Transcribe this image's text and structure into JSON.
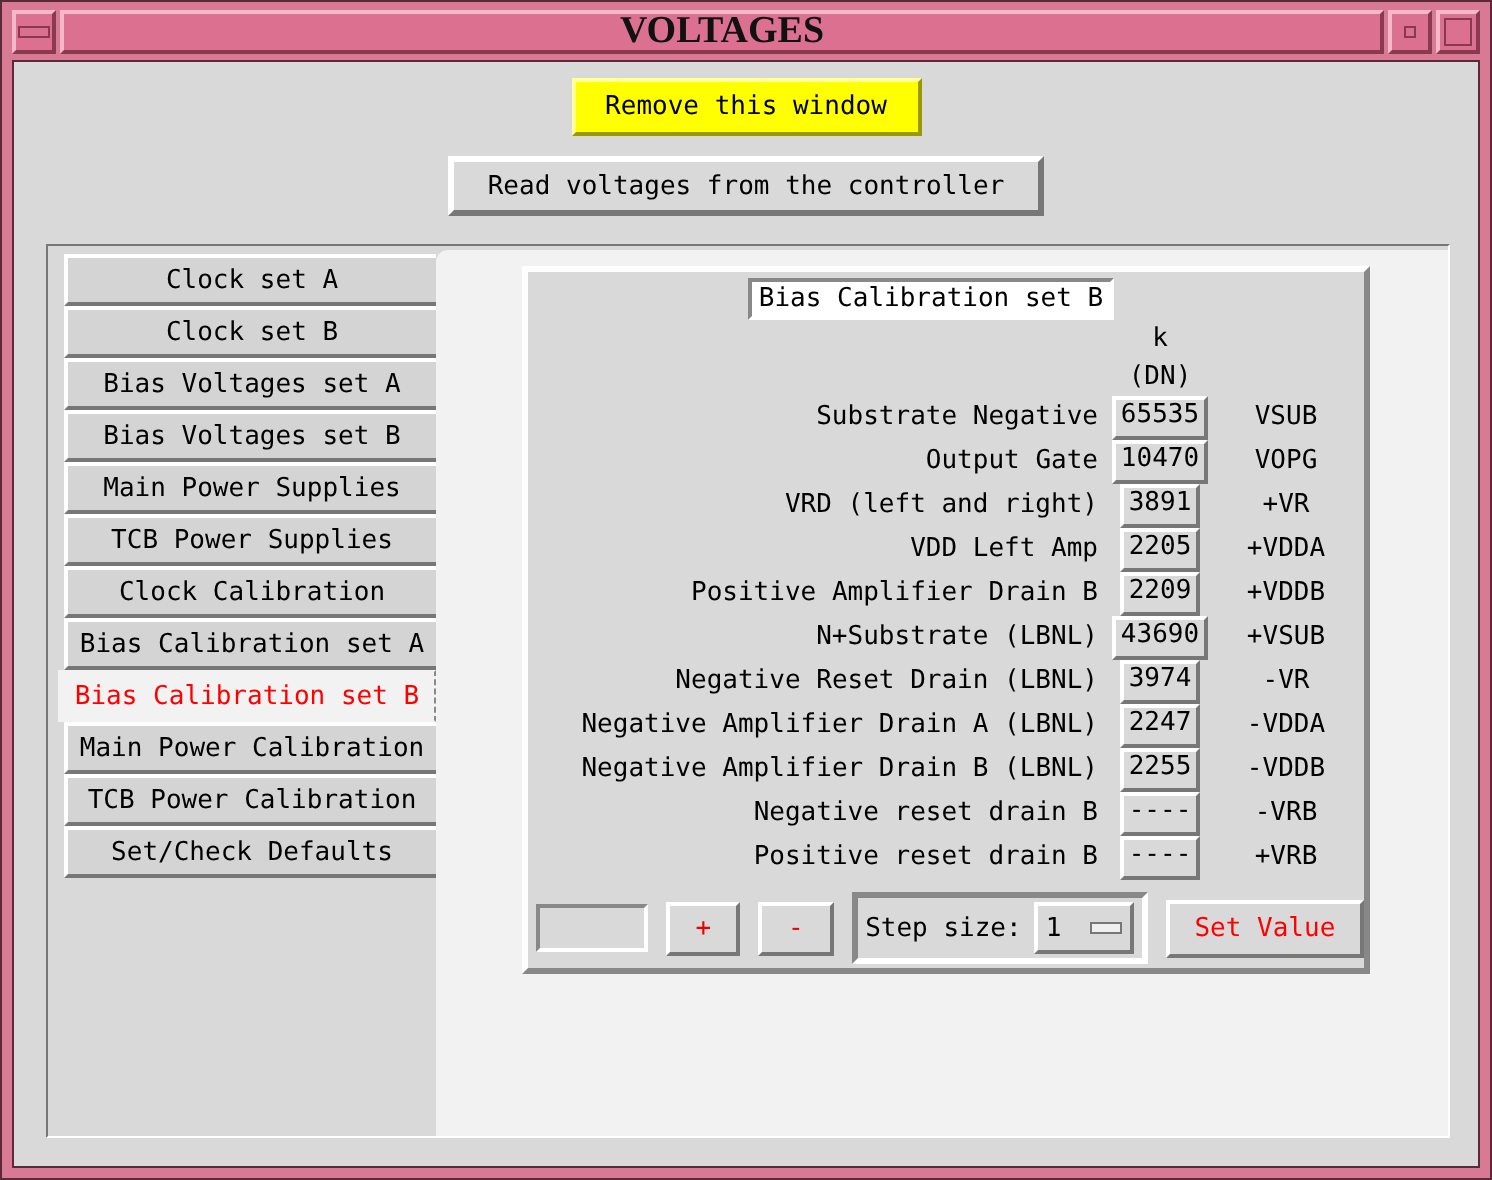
{
  "window": {
    "title": "VOLTAGES"
  },
  "remove_button": "Remove this window",
  "read_button": "Read voltages from the controller",
  "tabs": [
    {
      "label": "Clock set A",
      "selected": false
    },
    {
      "label": "Clock set B",
      "selected": false
    },
    {
      "label": "Bias Voltages set A",
      "selected": false
    },
    {
      "label": "Bias Voltages set B",
      "selected": false
    },
    {
      "label": "Main Power Supplies",
      "selected": false
    },
    {
      "label": "TCB Power Supplies",
      "selected": false
    },
    {
      "label": "Clock Calibration",
      "selected": false
    },
    {
      "label": "Bias Calibration set A",
      "selected": false
    },
    {
      "label": "Bias Calibration set B",
      "selected": true
    },
    {
      "label": "Main Power Calibration",
      "selected": false
    },
    {
      "label": "TCB Power Calibration",
      "selected": false
    },
    {
      "label": "Set/Check Defaults",
      "selected": false
    }
  ],
  "panel": {
    "title": "Bias Calibration set B",
    "column_header": [
      "k",
      "(DN)"
    ],
    "rows": [
      {
        "label": "Substrate Negative",
        "value": "65535",
        "unit": "VSUB"
      },
      {
        "label": "Output Gate",
        "value": "10470",
        "unit": "VOPG"
      },
      {
        "label": "VRD (left and right)",
        "value": "3891",
        "unit": "+VR"
      },
      {
        "label": "VDD Left Amp",
        "value": "2205",
        "unit": "+VDDA"
      },
      {
        "label": "Positive Amplifier Drain B",
        "value": "2209",
        "unit": "+VDDB"
      },
      {
        "label": "N+Substrate (LBNL)",
        "value": "43690",
        "unit": "+VSUB"
      },
      {
        "label": "Negative Reset Drain (LBNL)",
        "value": "3974",
        "unit": "-VR"
      },
      {
        "label": "Negative Amplifier Drain A (LBNL)",
        "value": "2247",
        "unit": "-VDDA"
      },
      {
        "label": "Negative Amplifier Drain B (LBNL)",
        "value": "2255",
        "unit": "-VDDB"
      },
      {
        "label": "Negative reset drain B",
        "value": "----",
        "unit": "-VRB"
      },
      {
        "label": "Positive reset drain B",
        "value": "----",
        "unit": "+VRB"
      }
    ],
    "controls": {
      "plus": "+",
      "minus": "-",
      "step_label": "Step size:",
      "step_value": "1",
      "set_button": "Set Value"
    }
  }
}
